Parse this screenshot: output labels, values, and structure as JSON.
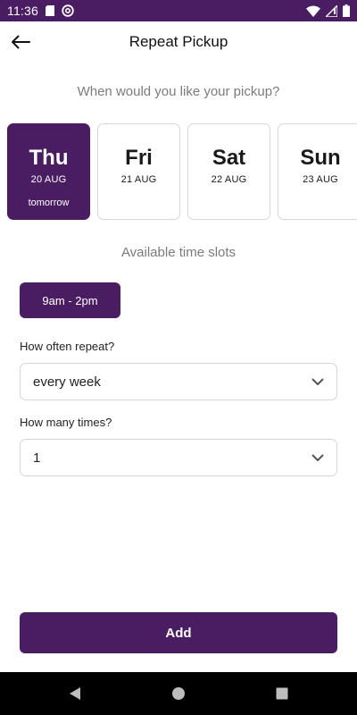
{
  "status_bar": {
    "time": "11:36",
    "left_icons": [
      "sd-card-icon",
      "at-sign-icon"
    ],
    "right_icons": [
      "wifi-icon",
      "signal-icon",
      "battery-icon"
    ],
    "color": "#4a1d63"
  },
  "header": {
    "title": "Repeat Pickup",
    "back_icon": "arrow-left-icon"
  },
  "question": "When would you like your pickup?",
  "days": [
    {
      "name": "Thu",
      "date": "20 AUG",
      "sub": "tomorrow",
      "selected": true
    },
    {
      "name": "Fri",
      "date": "21 AUG",
      "sub": "",
      "selected": false
    },
    {
      "name": "Sat",
      "date": "22 AUG",
      "sub": "",
      "selected": false
    },
    {
      "name": "Sun",
      "date": "23 AUG",
      "sub": "",
      "selected": false
    }
  ],
  "slots": {
    "label": "Available time slots",
    "items": [
      {
        "label": "9am - 2pm",
        "selected": true
      }
    ]
  },
  "repeat": {
    "label": "How often repeat?",
    "value": "every week"
  },
  "times": {
    "label": "How many times?",
    "value": "1"
  },
  "actions": {
    "add_label": "Add"
  },
  "theme": {
    "accent": "#4a1d63",
    "muted_text": "#7a7a80",
    "border": "#d6d6d6"
  },
  "nav_bar": {
    "icons": [
      "back-triangle-icon",
      "home-circle-icon",
      "recents-square-icon"
    ]
  }
}
